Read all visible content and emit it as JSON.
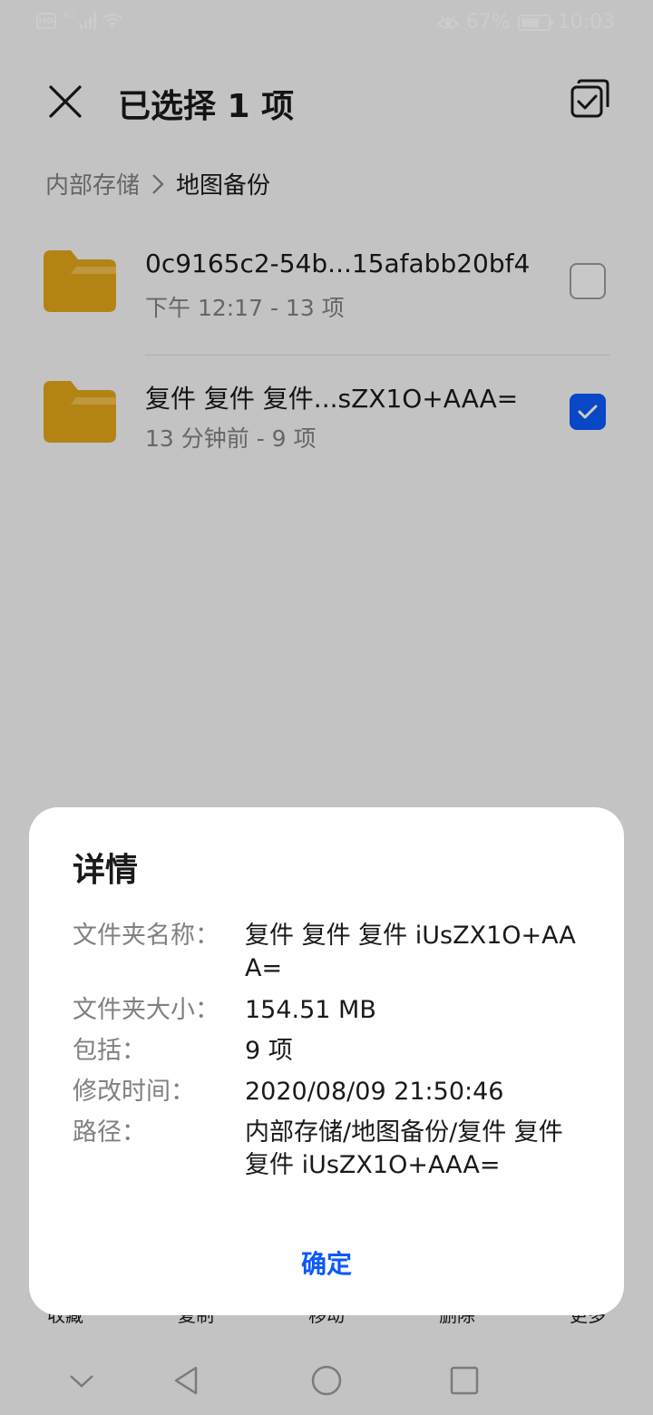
{
  "status_bar": {
    "network_label": "4G",
    "battery_percent": "67%",
    "time": "10:03",
    "icons": [
      "hd-icon",
      "signal-icon",
      "wifi-icon",
      "eye-icon",
      "battery-icon"
    ],
    "battery_level": 0.67
  },
  "header": {
    "title": "已选择 1 项",
    "icons": [
      "close-icon",
      "select-all-icon"
    ]
  },
  "breadcrumb": {
    "root": "内部存储",
    "current": "地图备份"
  },
  "files": [
    {
      "name": "0c9165c2-54b...15afabb20bf4",
      "meta": "下午 12:17  - 13 项",
      "checked": false
    },
    {
      "name": "复件 复件 复件...sZX1O+AAA=",
      "meta": "13 分钟前 - 9 项",
      "checked": true
    }
  ],
  "toolbar": {
    "items": [
      "收藏",
      "复制",
      "移动",
      "删除",
      "更多"
    ]
  },
  "dialog": {
    "title": "详情",
    "rows": [
      {
        "label": "文件夹名称：",
        "value": "复件 复件 复件 iUsZX1O+AAA="
      },
      {
        "label": "文件夹大小：",
        "value": "154.51 MB"
      },
      {
        "label": "包括：",
        "value": "9 项"
      },
      {
        "label": "修改时间：",
        "value": "2020/08/09 21:50:46"
      },
      {
        "label": "路径：",
        "value": "内部存储/地图备份/复件 复件 复件 iUsZX1O+AAA="
      }
    ],
    "confirm_label": "确定"
  },
  "colors": {
    "accent": "#0a59f7",
    "folder": "#e0a41a",
    "scrim": "rgba(0,0,0,0.20)"
  }
}
